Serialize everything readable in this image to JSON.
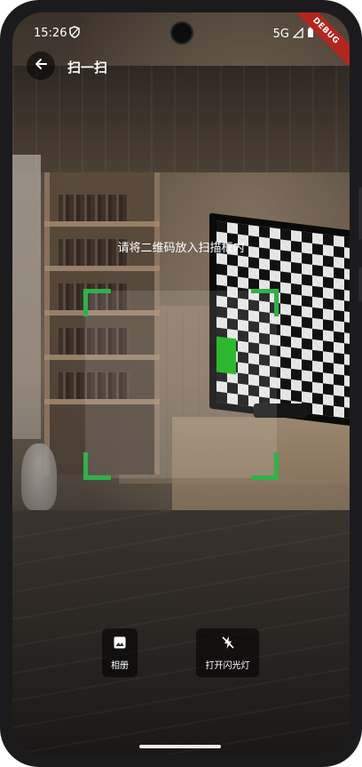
{
  "status_bar": {
    "time": "15:26",
    "network": "5G"
  },
  "debug_banner": "DEBUG",
  "app_bar": {
    "title": "扫一扫"
  },
  "scanner": {
    "hint": "请将二维码放入扫描框内",
    "accent_color": "#2fb24a"
  },
  "actions": {
    "album_label": "相册",
    "flash_label": "打开闪光灯"
  }
}
